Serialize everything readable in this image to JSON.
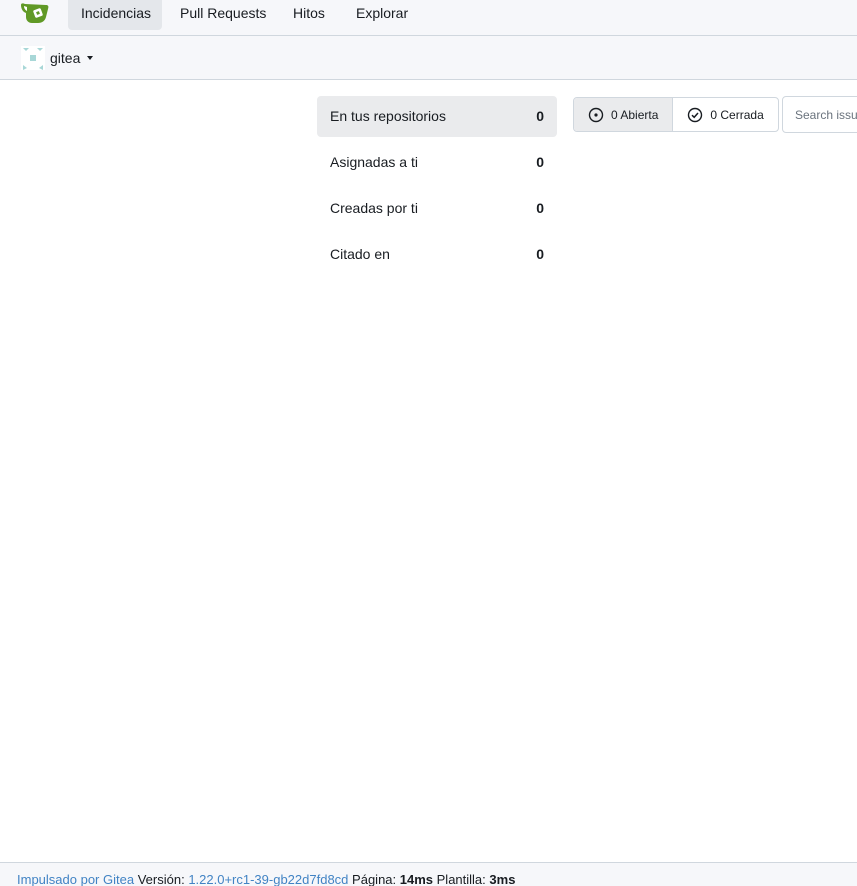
{
  "nav": {
    "logo_icon": "gitea-teacup-logo",
    "items": [
      {
        "label": "Incidencias",
        "active": true
      },
      {
        "label": "Pull Requests",
        "active": false
      },
      {
        "label": "Hitos",
        "active": false
      },
      {
        "label": "Explorar",
        "active": false
      }
    ]
  },
  "context": {
    "avatar_icon": "org-identicon",
    "name": "gitea",
    "dropdown_icon": "caret-down-icon"
  },
  "filters": [
    {
      "label": "En tus repositorios",
      "count": "0",
      "active": true
    },
    {
      "label": "Asignadas a ti",
      "count": "0",
      "active": false
    },
    {
      "label": "Creadas por ti",
      "count": "0",
      "active": false
    },
    {
      "label": "Citado en",
      "count": "0",
      "active": false
    }
  ],
  "state": {
    "open_label": "0 Abierta",
    "open_icon": "issue-opened-icon",
    "closed_label": "0 Cerrada",
    "closed_icon": "issue-closed-icon"
  },
  "search": {
    "placeholder": "Search issues...",
    "value": ""
  },
  "footer": {
    "powered_by": "Impulsado por Gitea",
    "version_label": "Versión:",
    "version": "1.22.0+rc1-39-gb22d7fd8cd",
    "page_label": "Página:",
    "page_time": "14ms",
    "template_label": "Plantilla:",
    "template_time": "3ms"
  },
  "colors": {
    "accent": "#609926",
    "link": "#4183c4",
    "nav_bg": "#f6f7fa",
    "active_bg": "#eaebed"
  }
}
